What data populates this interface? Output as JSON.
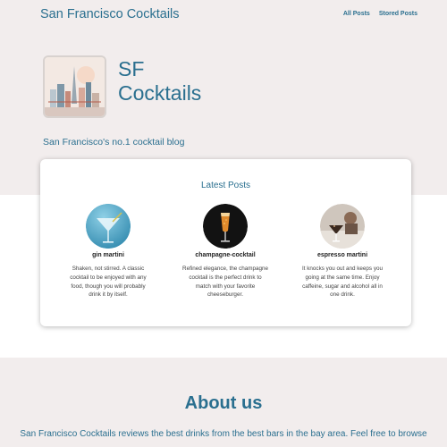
{
  "header": {
    "site_title": "San Francisco Cocktails",
    "nav": [
      {
        "label": "All Posts"
      },
      {
        "label": "Stored Posts"
      }
    ]
  },
  "hero": {
    "title_line1": "SF",
    "title_line2": "Cocktails",
    "tagline": "San Francisco's no.1 cocktail blog",
    "logo_icon": "san-francisco-skyline-icon"
  },
  "latest_posts": {
    "title": "Latest Posts",
    "posts": [
      {
        "name": "gin martini",
        "description_lines": [
          "Shaken, not stirred. A classic",
          "cocktail to be enjoyed with any",
          "food, though you will probably",
          "drink it by itself."
        ],
        "image": "martini-glass-photo"
      },
      {
        "name": "champagne-cocktail",
        "description_lines": [
          "Refined elegance, the champagne",
          "cocktail is the perfect drink to",
          "match with your favorite",
          "cheeseburger."
        ],
        "image": "champagne-flute-photo"
      },
      {
        "name": "espresso martini",
        "description_lines": [
          "It knocks you out and keeps you",
          "going at the same time. Enjoy",
          "caffeine, sugar and alcohol all in",
          "one drink."
        ],
        "image": "espresso-martini-photo"
      }
    ]
  },
  "about": {
    "title": "About us",
    "text": "San Francisco Cocktails reviews the best drinks from the best bars in the bay area. Feel free to browse"
  },
  "colors": {
    "accent": "#2a6f8f",
    "hero_background": "#f2eded",
    "card_background": "#ffffff"
  }
}
